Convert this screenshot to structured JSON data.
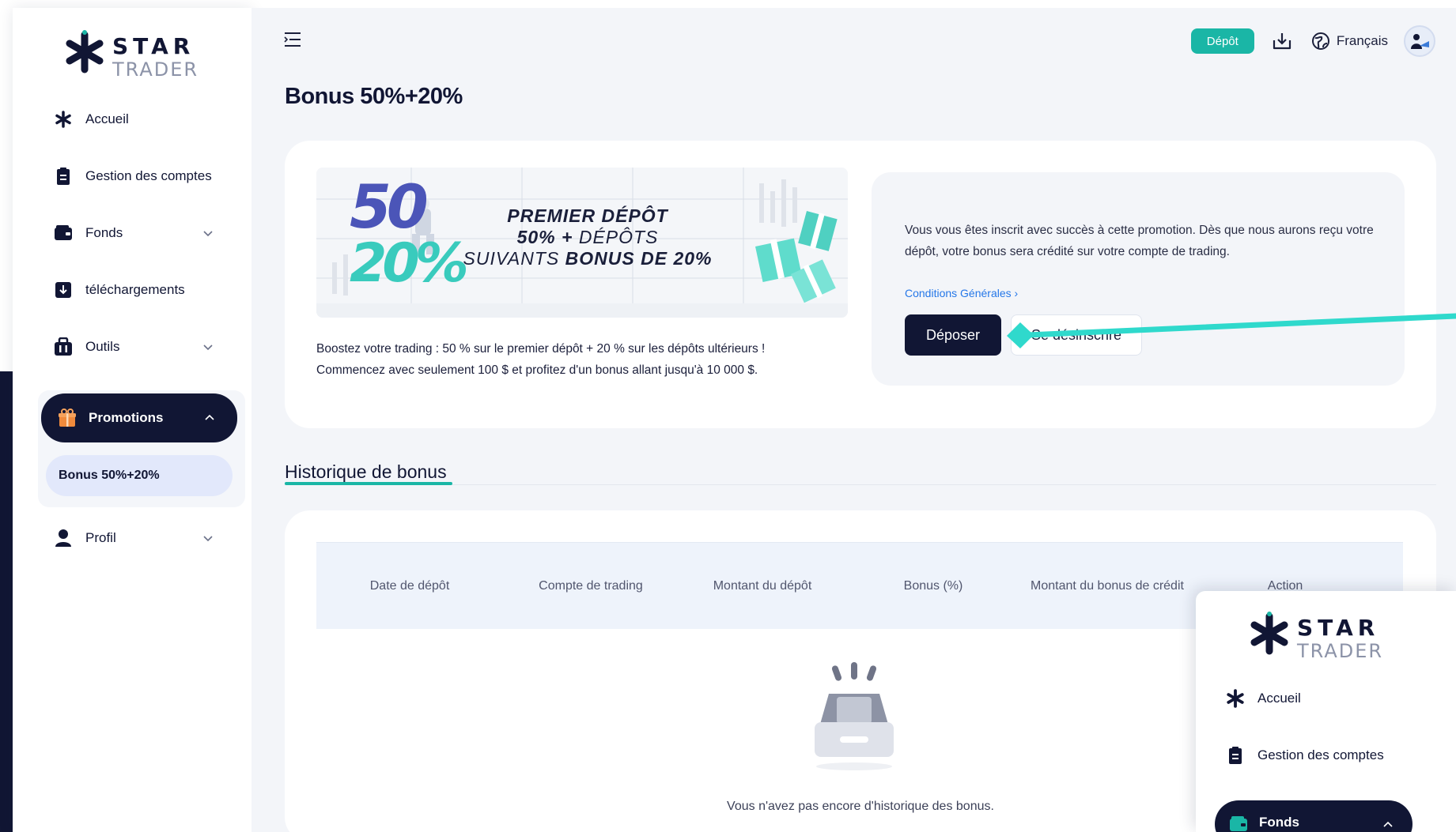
{
  "brand": {
    "star_text": "STAR",
    "trader_text": "TRADER",
    "accent_color": "#1ab6a6",
    "dark_color": "#111634"
  },
  "sidebar": {
    "items": [
      {
        "label": "Accueil",
        "icon": "star-icon"
      },
      {
        "label": "Gestion des comptes",
        "icon": "clipboard-icon"
      },
      {
        "label": "Fonds",
        "icon": "wallet-icon"
      },
      {
        "label": "téléchargements",
        "icon": "download-box-icon"
      },
      {
        "label": "Outils",
        "icon": "toolbox-icon"
      },
      {
        "label": "Promotions",
        "icon": "gift-icon"
      },
      {
        "label": "Profil",
        "icon": "user-icon"
      }
    ],
    "promotions_sub": "Bonus 50%+20%"
  },
  "topbar": {
    "deposit_label": "Dépôt",
    "language": "Français"
  },
  "page": {
    "title": "Bonus 50%+20%"
  },
  "promo": {
    "banner_big_top": "50",
    "banner_big_bottom": "20%",
    "banner_line1": "PREMIER DÉPÔT",
    "banner_line2a": "50% +",
    "banner_line2b": " DÉPÔTS",
    "banner_line3a": "SUIVANTS ",
    "banner_line3b": "BONUS DE 20%",
    "description_line1": "Boostez votre trading : 50 % sur le premier dépôt + 20 % sur les dépôts ultérieurs !",
    "description_line2": "Commencez avec seulement 100 $ et profitez d'un bonus allant jusqu'à 10 000 $.",
    "info_text": "Vous vous êtes inscrit avec succès à cette promotion. Dès que nous aurons reçu votre dépôt, votre bonus sera crédité sur votre compte de trading.",
    "terms_link": "Conditions Générales",
    "deposit_button": "Déposer",
    "unsubscribe_button": "Se désinscrire"
  },
  "history": {
    "tab_label": "Historique de bonus",
    "columns": [
      "Date de dépôt",
      "Compte de trading",
      "Montant du dépôt",
      "Bonus (%)",
      "Montant du bonus de crédit",
      "Action"
    ],
    "empty_message": "Vous n'avez pas encore d'historique des bonus."
  },
  "overlay": {
    "items": [
      {
        "label": "Accueil",
        "icon": "star-icon"
      },
      {
        "label": "Gestion des comptes",
        "icon": "clipboard-icon"
      },
      {
        "label": "Fonds",
        "icon": "wallet-icon"
      }
    ]
  }
}
